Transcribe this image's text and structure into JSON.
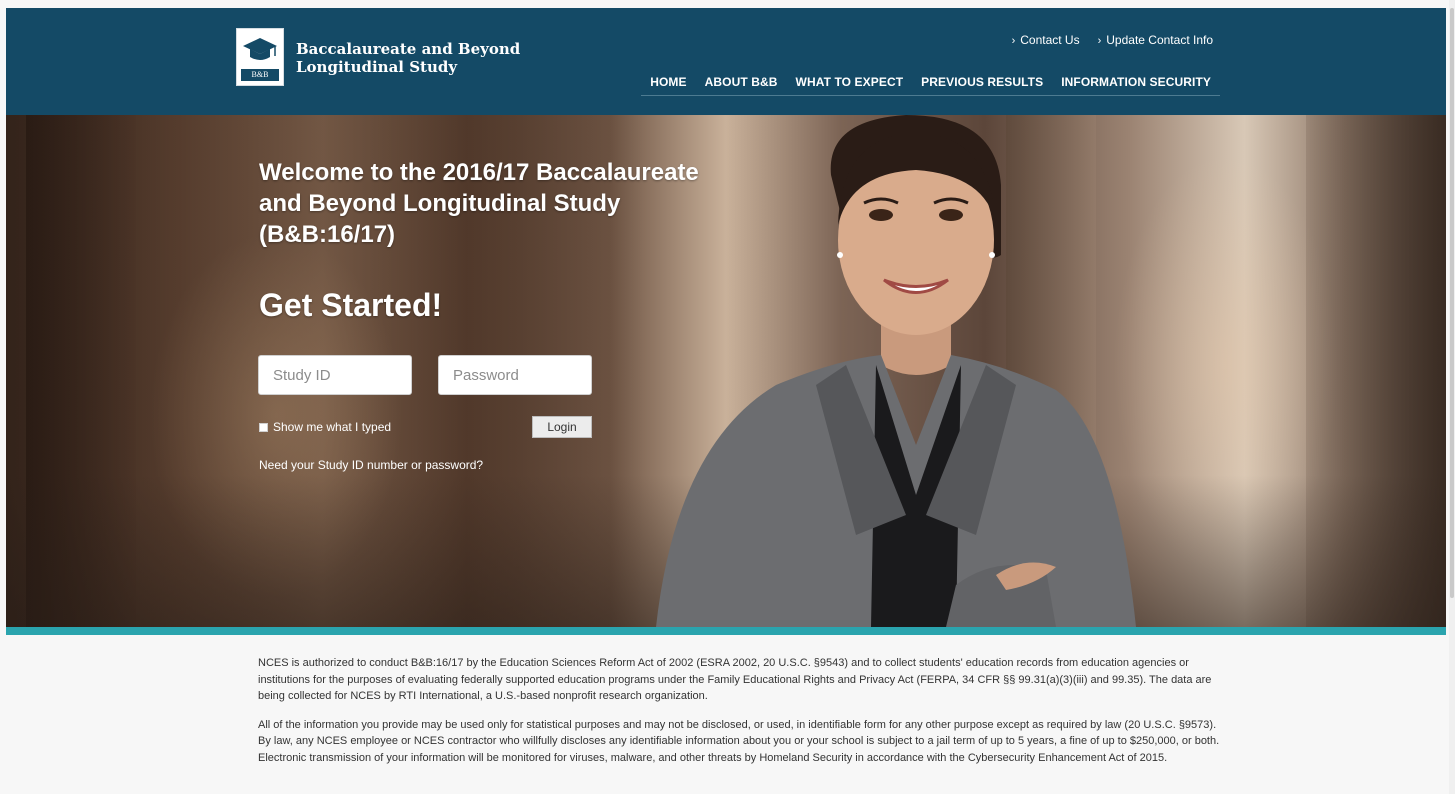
{
  "header": {
    "logo_line1": "Baccalaureate and Beyond",
    "logo_line2": "Longitudinal Study",
    "logo_tag": "B&B",
    "util_links": [
      {
        "label": "Contact Us"
      },
      {
        "label": "Update Contact Info"
      }
    ],
    "nav": [
      {
        "label": "HOME"
      },
      {
        "label": "ABOUT B&B"
      },
      {
        "label": "WHAT TO EXPECT"
      },
      {
        "label": "PREVIOUS RESULTS"
      },
      {
        "label": "INFORMATION SECURITY"
      }
    ],
    "color": "#144a66"
  },
  "hero": {
    "welcome_line1": "Welcome to the 2016/17 Baccalaureate",
    "welcome_line2": "and Beyond Longitudinal Study",
    "welcome_line3": "(B&B:16/17)",
    "get_started": "Get Started!",
    "study_id_placeholder": "Study ID",
    "password_placeholder": "Password",
    "show_typed_label": "Show me what I typed",
    "login_label": "Login",
    "need_help_link": "Need your Study ID number or password?"
  },
  "accent_color": "#2aa4ae",
  "body": {
    "paragraph1": "NCES is authorized to conduct B&B:16/17 by the Education Sciences Reform Act of 2002 (ESRA 2002, 20 U.S.C. §9543) and to collect students' education records from education agencies or institutions for the purposes of evaluating federally supported education programs under the Family Educational Rights and Privacy Act (FERPA, 34 CFR §§ 99.31(a)(3)(iii) and 99.35). The data are being collected for NCES by RTI International, a U.S.-based nonprofit research organization.",
    "paragraph2": "All of the information you provide may be used only for statistical purposes and may not be disclosed, or used, in identifiable form for any other purpose except as required by law (20 U.S.C. §9573). By law, any NCES employee or NCES contractor who willfully discloses any identifiable information about you or your school is subject to a jail term of up to 5 years, a fine of up to $250,000, or both. Electronic transmission of your information will be monitored for viruses, malware, and other threats by Homeland Security in accordance with the Cybersecurity Enhancement Act of 2015."
  }
}
